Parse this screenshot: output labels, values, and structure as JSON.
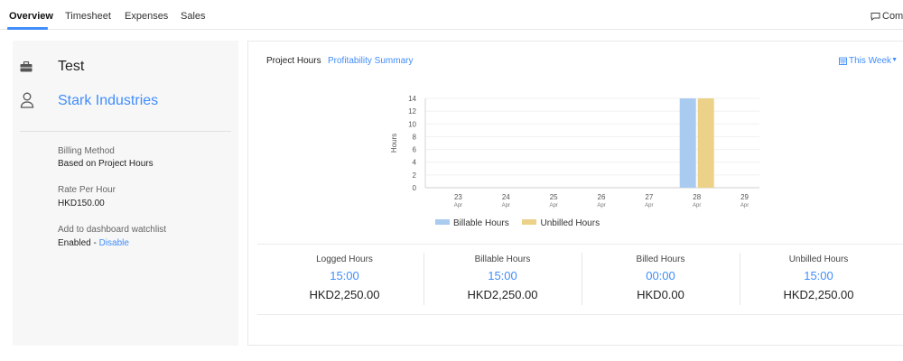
{
  "tabs": [
    {
      "label": "Overview",
      "active": true
    },
    {
      "label": "Timesheet",
      "active": false
    },
    {
      "label": "Expenses",
      "active": false
    },
    {
      "label": "Sales",
      "active": false
    }
  ],
  "comments_label": "Comm",
  "project": {
    "title": "Test",
    "customer": "Stark Industries",
    "billing_method_label": "Billing Method",
    "billing_method_value": "Based on Project Hours",
    "rate_label": "Rate Per Hour",
    "rate_value": "HKD150.00",
    "watchlist_label": "Add to dashboard watchlist",
    "watchlist_status": "Enabled - ",
    "watchlist_action": "Disable"
  },
  "card": {
    "subtab_active": "Project Hours",
    "subtab_other": "Profitability Summary",
    "period": "This Week"
  },
  "colors": {
    "accent": "#408dfb",
    "billable": "#a9cbef",
    "unbilled": "#ecd188"
  },
  "chart_data": {
    "type": "bar",
    "ylabel": "Hours",
    "ylim": [
      0,
      14
    ],
    "yticks": [
      0,
      2,
      4,
      6,
      8,
      10,
      12,
      14
    ],
    "categories": [
      {
        "day": "23",
        "month": "Apr"
      },
      {
        "day": "24",
        "month": "Apr"
      },
      {
        "day": "25",
        "month": "Apr"
      },
      {
        "day": "26",
        "month": "Apr"
      },
      {
        "day": "27",
        "month": "Apr"
      },
      {
        "day": "28",
        "month": "Apr"
      },
      {
        "day": "29",
        "month": "Apr"
      }
    ],
    "series": [
      {
        "name": "Billable Hours",
        "color": "#a9cbef",
        "values": [
          0,
          0,
          0,
          0,
          0,
          15,
          0
        ]
      },
      {
        "name": "Unbilled Hours",
        "color": "#ecd188",
        "values": [
          0,
          0,
          0,
          0,
          0,
          15,
          0
        ]
      }
    ],
    "legend": "bottom"
  },
  "summary": [
    {
      "label": "Logged Hours",
      "hours": "15:00",
      "amount": "HKD2,250.00"
    },
    {
      "label": "Billable Hours",
      "hours": "15:00",
      "amount": "HKD2,250.00"
    },
    {
      "label": "Billed Hours",
      "hours": "00:00",
      "amount": "HKD0.00"
    },
    {
      "label": "Unbilled Hours",
      "hours": "15:00",
      "amount": "HKD2,250.00"
    }
  ]
}
